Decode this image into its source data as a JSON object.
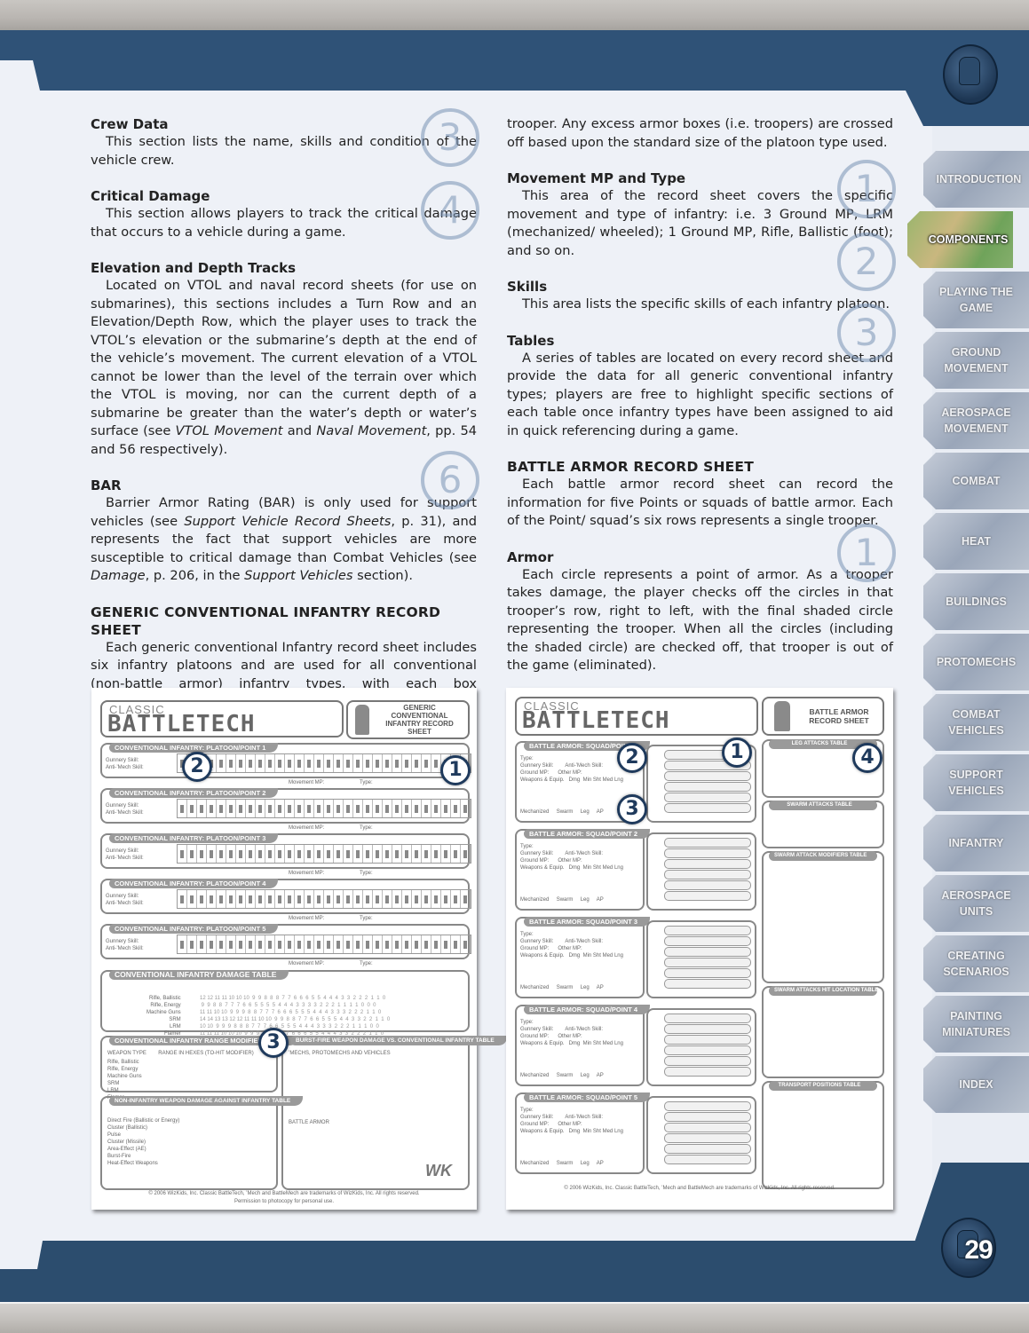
{
  "page_number": "29",
  "nav_tabs": [
    {
      "label": "Introduction",
      "active": false
    },
    {
      "label": "Components",
      "active": true
    },
    {
      "label": "Playing the Game",
      "active": false
    },
    {
      "label": "Ground Movement",
      "active": false
    },
    {
      "label": "Aerospace Movement",
      "active": false
    },
    {
      "label": "Combat",
      "active": false
    },
    {
      "label": "Heat",
      "active": false
    },
    {
      "label": "Buildings",
      "active": false
    },
    {
      "label": "ProtoMechs",
      "active": false
    },
    {
      "label": "Combat Vehicles",
      "active": false
    },
    {
      "label": "Support Vehicles",
      "active": false
    },
    {
      "label": "Infantry",
      "active": false
    },
    {
      "label": "Aerospace Units",
      "active": false
    },
    {
      "label": "Creating Scenarios",
      "active": false
    },
    {
      "label": "Painting Miniatures",
      "active": false
    },
    {
      "label": "Index",
      "active": false
    }
  ],
  "left_column": {
    "crew_data": {
      "heading": "Crew Data",
      "body": "This section lists the name, skills and condition of the vehicle crew.",
      "marker": "3"
    },
    "critical_damage": {
      "heading": "Critical Damage",
      "body": "This section allows players to track the critical damage that occurs to a vehicle during a game.",
      "marker": "4"
    },
    "elevation": {
      "heading": "Elevation and Depth Tracks",
      "body_pre": "Located on VTOL and naval record sheets (for use on submarines), this sections includes a Turn Row and an Elevation/Depth Row, which the player uses to track the VTOL’s elevation or the submarine’s depth at the end of the vehicle’s movement. The current elevation of a VTOL cannot be lower than the level of the terrain over which the VTOL is moving, nor can the current depth of a submarine be greater than the water’s depth or water’s surface (see ",
      "ref1": "VTOL Movement",
      "mid": " and ",
      "ref2": "Naval Movement",
      "post": ", pp. 54 and 56 respectively)."
    },
    "bar": {
      "heading": "BAR",
      "marker": "6",
      "body_a": "Barrier Armor Rating (BAR) is only used for support vehicles (see ",
      "ref1": "Support Vehicle Record Sheets",
      "body_b": ", p. 31), and represents the fact that support vehicles are more susceptible to critical damage than Combat Vehicles (see ",
      "ref2": "Damage",
      "body_c": ", p. 206, in the ",
      "ref3": "Support Vehicles",
      "body_d": " section)."
    },
    "infantry_sheet": {
      "heading": "GENERIC CONVENTIONAL INFANTRY RECORD SHEET",
      "body": "Each generic conventional Infantry record sheet includes six infantry platoons and are used for all conventional (non-battle armor) infantry types, with each box representing an individual"
    }
  },
  "right_column": {
    "continuation": "trooper. Any excess armor boxes (i.e. troopers) are crossed off based upon the standard size of the platoon type used.",
    "movement": {
      "heading": "Movement MP and Type",
      "body": "This area of the record sheet covers the specific movement and type of infantry: i.e. 3 Ground MP, LRM (mechanized/ wheeled); 1 Ground MP, Rifle, Ballistic (foot); and so on.",
      "marker": "1"
    },
    "skills": {
      "heading": "Skills",
      "body": "This area lists the specific skills of each infantry platoon.",
      "marker": "2"
    },
    "tables": {
      "heading": "Tables",
      "body": "A series of tables are located on every record sheet and provide the data for all generic conventional infantry types; players are free to highlight specific sections of each table once infantry types have been assigned to aid in quick referencing during a game.",
      "marker": "3"
    },
    "battle_armor_sheet": {
      "heading": "BATTLE ARMOR RECORD SHEET",
      "body": "Each battle armor record sheet can record the information for five Points or squads of battle armor. Each of the Point/ squad’s six rows represents a single trooper."
    },
    "armor": {
      "heading": "Armor",
      "body": "Each circle represents a point of armor. As a trooper takes damage, the player checks off the circles in that trooper’s row, right to left, with the final shaded circle representing the trooper. When all the circles (including the shaded circle) are checked off, that trooper is out of the game (eliminated).",
      "marker": "1"
    }
  },
  "infantry_record_sheet": {
    "logo_top": "CLASSIC",
    "logo_main": "BATTLETECH",
    "title": "GENERIC CONVENTIONAL INFANTRY RECORD SHEET",
    "platoons": [
      {
        "title": "CONVENTIONAL INFANTRY: PLATOON/POINT 1"
      },
      {
        "title": "CONVENTIONAL INFANTRY: PLATOON/POINT 2"
      },
      {
        "title": "CONVENTIONAL INFANTRY: PLATOON/POINT 3"
      },
      {
        "title": "CONVENTIONAL INFANTRY: PLATOON/POINT 4"
      },
      {
        "title": "CONVENTIONAL INFANTRY: PLATOON/POINT 5"
      }
    ],
    "gunnery_label": "Gunnery Skill:",
    "antimech_label": "Anti-’Mech Skill:",
    "movement_label": "Movement MP:",
    "type_label": "Type:",
    "damage_table_title": "CONVENTIONAL INFANTRY DAMAGE TABLE",
    "damage_table_rows": [
      "Rifle, Ballistic",
      "Rifle, Energy",
      "Machine Guns",
      "SRM",
      "LRM",
      "Flamer"
    ],
    "range_table_title": "CONVENTIONAL INFANTRY RANGE MODIFIER TABLE",
    "range_table_header": "WEAPON TYPE        RANGE IN HEXES (TO-HIT MODIFIER)",
    "range_table_rows": [
      "Rifle, Ballistic",
      "Rifle, Energy",
      "Machine Guns",
      "SRM",
      "LRM",
      "Flamer"
    ],
    "burst_table_title": "BURST-FIRE WEAPON DAMAGE VS. CONVENTIONAL INFANTRY TABLE",
    "burst_sub1": "’MECHS, PROTOMECHS AND VEHICLES",
    "burst_sub2": "BATTLE ARMOR",
    "nonInf_table_title": "NON-INFANTRY WEAPON DAMAGE AGAINST INFANTRY TABLE",
    "nonInf_rows": [
      "Direct Fire (Ballistic or Energy)",
      "Cluster (Ballistic)",
      "Pulse",
      "Cluster (Missile)",
      "Area-Effect (AE)",
      "Burst-Fire",
      "Heat-Effect Weapons"
    ],
    "copyright": "© 2006 WizKids, Inc. Classic BattleTech, ’Mech and BattleMech are trademarks of WizKids, Inc. All rights reserved.",
    "permission": "Permission to photocopy for personal use.",
    "markers": [
      "2",
      "1",
      "3"
    ]
  },
  "battle_armor_record_sheet": {
    "logo_top": "CLASSIC",
    "logo_main": "BATTLETECH",
    "title": "BATTLE ARMOR RECORD SHEET",
    "squads": [
      {
        "title": "BATTLE ARMOR: SQUAD/POINT 1"
      },
      {
        "title": "BATTLE ARMOR: SQUAD/POINT 2"
      },
      {
        "title": "BATTLE ARMOR: SQUAD/POINT 3"
      },
      {
        "title": "BATTLE ARMOR: SQUAD/POINT 4"
      },
      {
        "title": "BATTLE ARMOR: SQUAD/POINT 5"
      }
    ],
    "squad_fields": "Type:\nGunnery Skill:        Anti-’Mech Skill:\nGround MP:      Other MP:\nWeapons & Equip.   Dmg  Min Sht Med Lng",
    "squad_checks": "Mechanized     Swarm     Leg     AP",
    "side_tables": [
      "LEG ATTACKS TABLE",
      "SWARM ATTACKS TABLE",
      "SWARM ATTACK MODIFIERS TABLE",
      "SWARM ATTACKS HIT LOCATION TABLE",
      "TRANSPORT POSITIONS TABLE"
    ],
    "copyright": "© 2006 WizKids, Inc. Classic BattleTech, ’Mech and BattleMech are trademarks of WizKids, Inc. All rights reserved.",
    "markers": [
      "1",
      "2",
      "3",
      "4"
    ]
  }
}
